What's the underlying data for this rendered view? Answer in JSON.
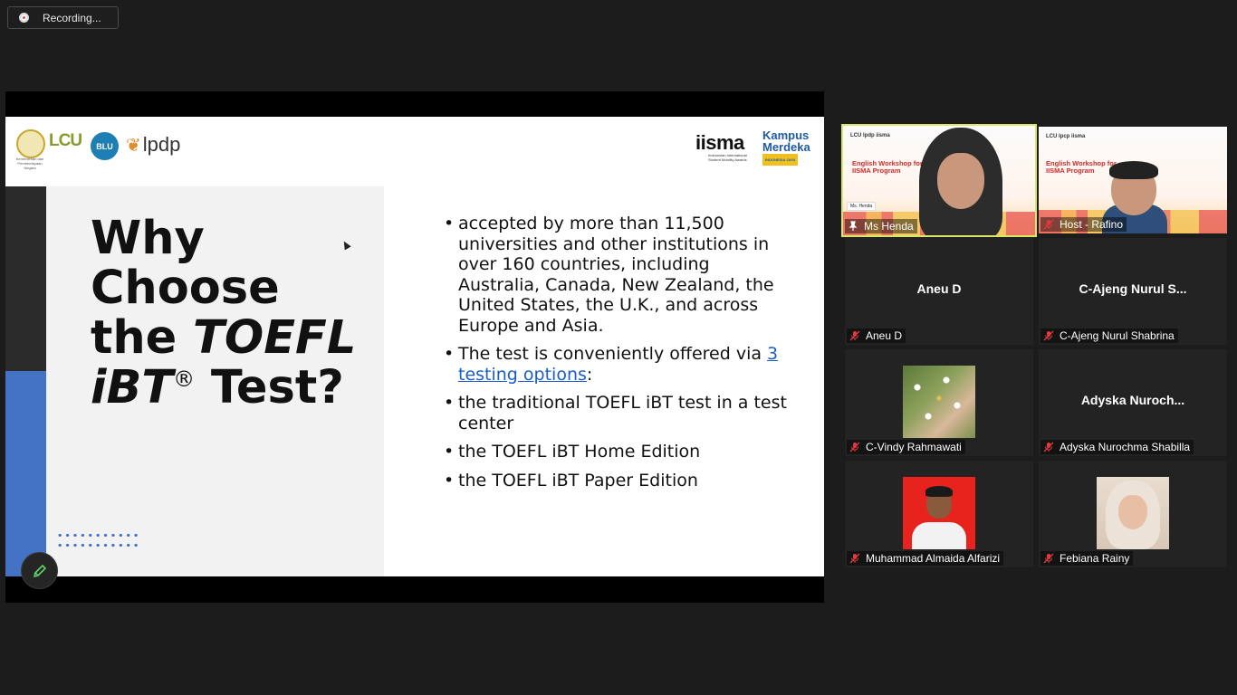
{
  "recording": {
    "label": "Recording..."
  },
  "slide": {
    "logos": {
      "seal_caption": "Kementerian dan Pemberdayaan Negara",
      "lcu": "LCU",
      "blu": "BLU",
      "lpdp": "lpdp",
      "iisma": "iisma",
      "iisma_caption": "Indonesian International Student Mobility Awards",
      "kampus": "Kampus",
      "merdeka": "Merdeka",
      "indonesia_jaya": "INDONESIA JAYA"
    },
    "title": {
      "line1": "Why",
      "line2": "Choose",
      "line3_a": "the ",
      "line3_b": "TOEFL",
      "line4_a": "iBT",
      "line4_reg": "®",
      "line4_b": " Test?"
    },
    "bullets": {
      "b1": "accepted by more than 11,500 universities and other institutions in over 160 countries, including Australia, Canada, New Zealand, the United States, the U.K., and across Europe and Asia.",
      "b2_a": "The test is conveniently offered via ",
      "b2_link": "3 testing options",
      "b2_b": ":",
      "b3": "the traditional TOEFL iBT test in a test center",
      "b4": "the TOEFL iBT Home Edition",
      "b5": "the TOEFL iBT Paper Edition"
    }
  },
  "participants": [
    {
      "label": "Ms Henda",
      "video_heading": "English Workshop for IISMA Program",
      "video_logos": "LCU  lpdp  iisma",
      "nametag": "Ms. Henda"
    },
    {
      "label": "Host - Rafino",
      "video_heading": "English Workshop for IISMA Program",
      "video_logos": "LCU  lpcp  iisma"
    },
    {
      "label": "Aneu D",
      "center_name": "Aneu D"
    },
    {
      "label": "C-Ajeng Nurul Shabrina",
      "center_name": "C-Ajeng  Nurul  S..."
    },
    {
      "label": "C-Vindy Rahmawati"
    },
    {
      "label": "Adyska Nurochma Shabilla",
      "center_name": "Adyska  Nuroch..."
    },
    {
      "label": "Muhammad Almaida Alfarizi"
    },
    {
      "label": "Febiana Rainy"
    }
  ],
  "colors": {
    "accent_blue": "#4472c4",
    "speaking_border": "#d9e86a",
    "link": "#1a5dc9",
    "mic_off": "#e0393e"
  }
}
